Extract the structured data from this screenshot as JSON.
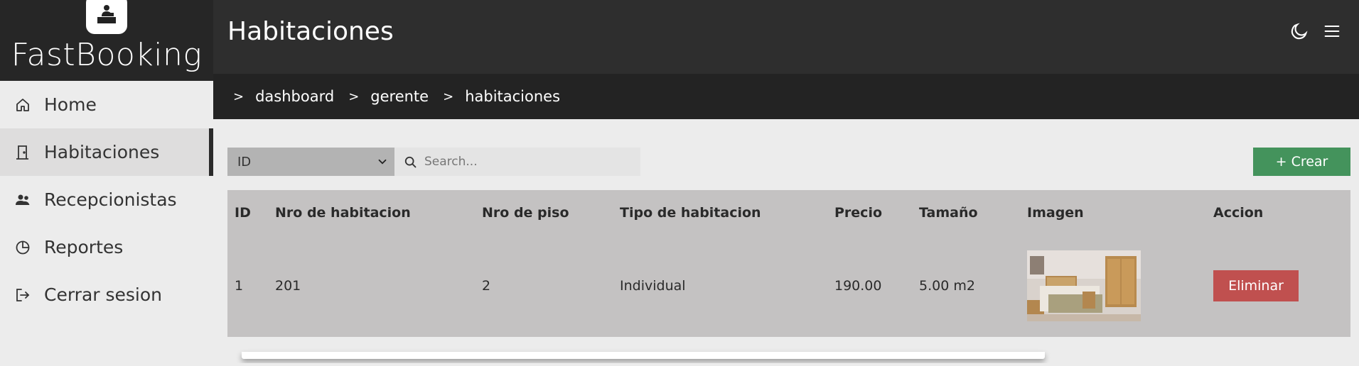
{
  "brand": {
    "name": "FastBooking",
    "logo_icon": "receptionist-icon"
  },
  "sidebar": {
    "items": [
      {
        "label": "Home",
        "icon": "home-icon",
        "active": false
      },
      {
        "label": "Habitaciones",
        "icon": "door-icon",
        "active": true
      },
      {
        "label": "Recepcionistas",
        "icon": "users-icon",
        "active": false
      },
      {
        "label": "Reportes",
        "icon": "pie-chart-icon",
        "active": false
      },
      {
        "label": "Cerrar sesion",
        "icon": "logout-icon",
        "active": false
      }
    ]
  },
  "header": {
    "title": "Habitaciones",
    "icons": [
      "moon-icon",
      "menu-icon"
    ]
  },
  "breadcrumb": [
    "dashboard",
    "gerente",
    "habitaciones"
  ],
  "toolbar": {
    "filter_selected": "ID",
    "search_placeholder": "Search...",
    "create_label": "+ Crear"
  },
  "table": {
    "headers": [
      "ID",
      "Nro de habitacion",
      "Nro de piso",
      "Tipo de habitacion",
      "Precio",
      "Tamaño",
      "Imagen",
      "Accion"
    ],
    "rows": [
      {
        "id": "1",
        "room": "201",
        "floor": "2",
        "type": "Individual",
        "price": "190.00",
        "size": "5.00 m2",
        "action": "Eliminar"
      }
    ]
  },
  "colors": {
    "sidebar_bg": "#ececec",
    "topbar_bg": "#2e2e2e",
    "breadcrumb_bg": "#232323",
    "create_button": "#44935c",
    "delete_button": "#c0504f",
    "table_bg": "#c4c2c2"
  }
}
